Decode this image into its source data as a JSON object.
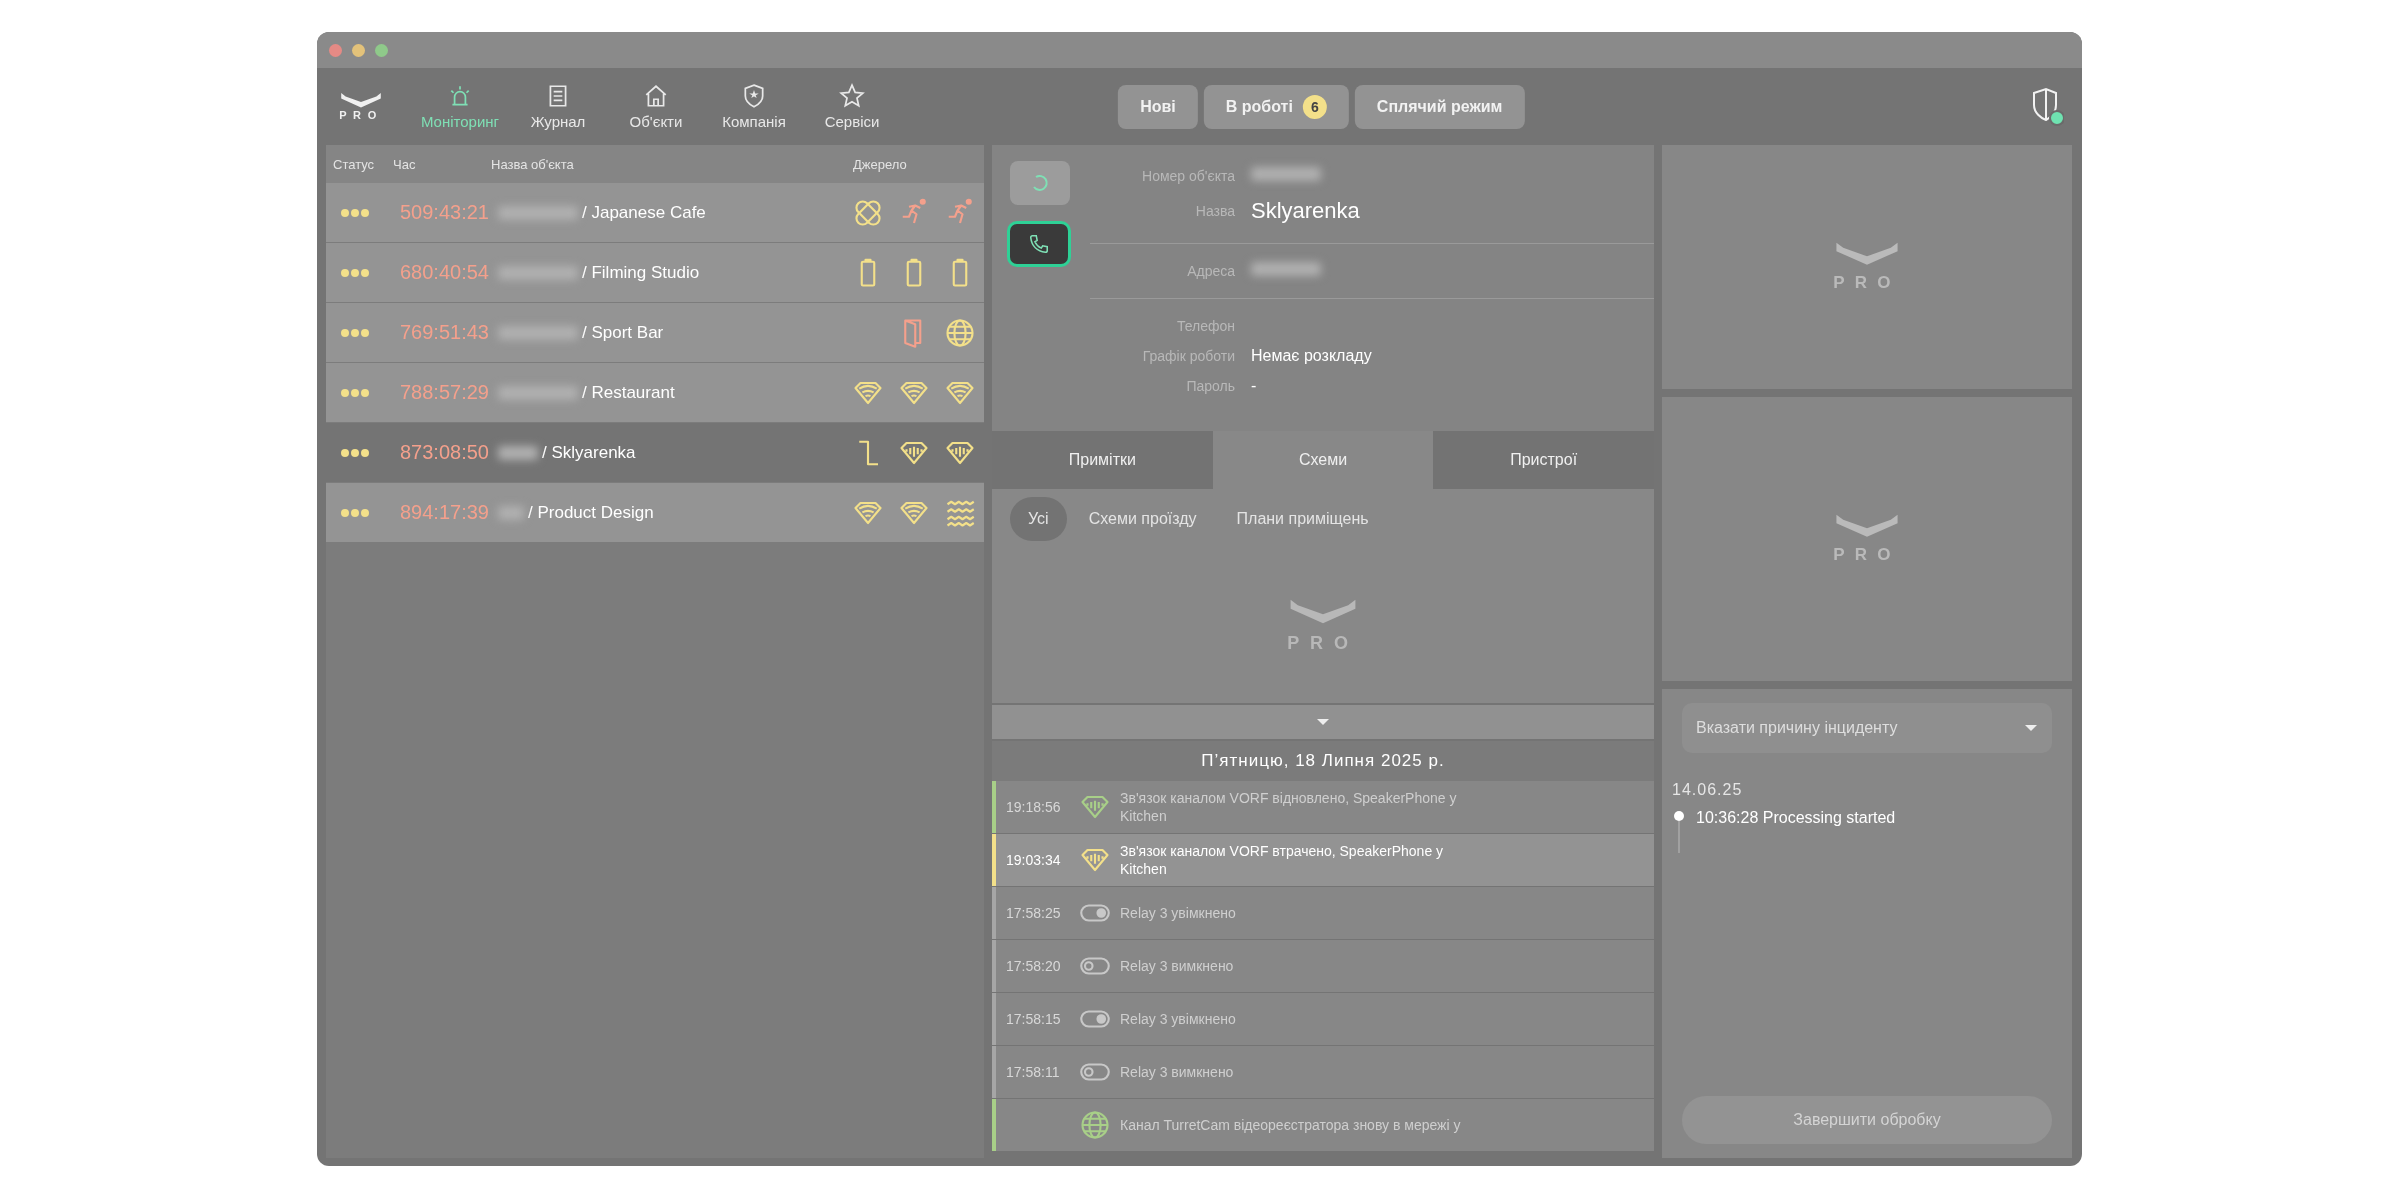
{
  "logo": {
    "text": "PRO"
  },
  "nav": [
    {
      "label": "Моніторинг",
      "selected": true
    },
    {
      "label": "Журнал",
      "selected": false
    },
    {
      "label": "Об'єкти",
      "selected": false
    },
    {
      "label": "Компанія",
      "selected": false
    },
    {
      "label": "Сервіси",
      "selected": false
    }
  ],
  "modes": [
    {
      "label": "Нові"
    },
    {
      "label": "В роботі",
      "badge": "6"
    },
    {
      "label": "Сплячий режим"
    }
  ],
  "incidents": {
    "columns": [
      "Статус",
      "Час",
      "Назва об'єкта",
      "Джерело"
    ],
    "rows": [
      {
        "time": "509:43:21",
        "name": "/ Japanese Cafe",
        "selected": false,
        "sources": [
          {
            "kind": "tamper",
            "color": "#f3e08a"
          },
          {
            "kind": "motion",
            "color": "#f4a08c"
          },
          {
            "kind": "motion",
            "color": "#f4a08c"
          }
        ]
      },
      {
        "time": "680:40:54",
        "name": "/ Filming Studio",
        "selected": false,
        "sources": [
          {
            "kind": "battery",
            "color": "#f3e08a"
          },
          {
            "kind": "battery",
            "color": "#f3e08a"
          },
          {
            "kind": "battery",
            "color": "#f3e08a"
          }
        ]
      },
      {
        "time": "769:51:43",
        "name": "/ Sport Bar",
        "selected": false,
        "sources": [
          {
            "kind": "door",
            "color": "#f4a08c"
          },
          {
            "kind": "globe",
            "color": "#f3e08a"
          }
        ]
      },
      {
        "time": "788:57:29",
        "name": "/ Restaurant",
        "selected": false,
        "sources": [
          {
            "kind": "wifi",
            "color": "#f3e08a"
          },
          {
            "kind": "wifi",
            "color": "#f3e08a"
          },
          {
            "kind": "wifi",
            "color": "#f3e08a"
          }
        ]
      },
      {
        "time": "873:08:50",
        "name": "/ Sklyarenka",
        "selected": true,
        "sources": [
          {
            "kind": "relay",
            "color": "#f3e08a"
          },
          {
            "kind": "speaker",
            "color": "#f3e08a"
          },
          {
            "kind": "speaker",
            "color": "#f3e08a"
          }
        ]
      },
      {
        "time": "894:17:39",
        "name": "/ Product Design",
        "selected": false,
        "sources": [
          {
            "kind": "wifi",
            "color": "#f3e08a"
          },
          {
            "kind": "wifi",
            "color": "#f3e08a"
          },
          {
            "kind": "flood",
            "color": "#f3e08a"
          }
        ]
      }
    ]
  },
  "object": {
    "fields": [
      {
        "label": "Номер об'єкта",
        "blurred": true
      },
      {
        "label": "Назва",
        "value": "Sklyarenka",
        "large": true
      },
      {
        "label": "Адреса",
        "blurred": true,
        "divider": true
      },
      {
        "label": "Телефон",
        "divider": true
      },
      {
        "label": "Графік роботи",
        "value": "Немає розкладу"
      },
      {
        "label": "Пароль",
        "value": "-"
      }
    ]
  },
  "tabs": [
    {
      "label": "Примітки",
      "selected": false
    },
    {
      "label": "Схеми",
      "selected": true
    },
    {
      "label": "Пристрої",
      "selected": false
    }
  ],
  "subtabs": [
    {
      "label": "Усі",
      "selected": true
    },
    {
      "label": "Схеми проїзду",
      "selected": false
    },
    {
      "label": "Плани приміщень",
      "selected": false
    }
  ],
  "scheme_logo": {
    "text": "PRO"
  },
  "events": {
    "date": "П’ятницю, 18 Липня 2025 р.",
    "items": [
      {
        "time": "19:18:56",
        "kind": "speaker",
        "color": "#a8cf88",
        "selected": false,
        "text": "Зв'язок каналом VORF відновлено, SpeakerPhone у Kitchen"
      },
      {
        "time": "19:03:34",
        "kind": "speaker",
        "color": "#f3e08a",
        "selected": true,
        "text": "Зв'язок каналом VORF втрачено, SpeakerPhone у Kitchen"
      },
      {
        "time": "17:58:25",
        "kind": "relay_on",
        "color": "#a6a6a6",
        "selected": false,
        "text": "Relay 3 увімкнено"
      },
      {
        "time": "17:58:20",
        "kind": "relay_off",
        "color": "#a6a6a6",
        "selected": false,
        "text": "Relay 3 вимкнено"
      },
      {
        "time": "17:58:15",
        "kind": "relay_on",
        "color": "#a6a6a6",
        "selected": false,
        "text": "Relay 3 увімкнено"
      },
      {
        "time": "17:58:11",
        "kind": "relay_off",
        "color": "#a6a6a6",
        "selected": false,
        "text": "Relay 3 вимкнено"
      },
      {
        "kind": "globe",
        "color": "#a8cf88",
        "selected": false,
        "text": "Канал TurretCam відеореєстратора знову в мережі у"
      }
    ]
  },
  "cameras": [
    {
      "text": "PRO"
    },
    {
      "text": "PRO"
    }
  ],
  "processing": {
    "reason": {
      "placeholder": "Вказати причину інциденту"
    },
    "log_date": "14.06.25",
    "log": [
      {
        "text": "10:36:28 Processing started"
      }
    ],
    "finish": {
      "label": "Завершити обробку",
      "disabled": true
    }
  }
}
